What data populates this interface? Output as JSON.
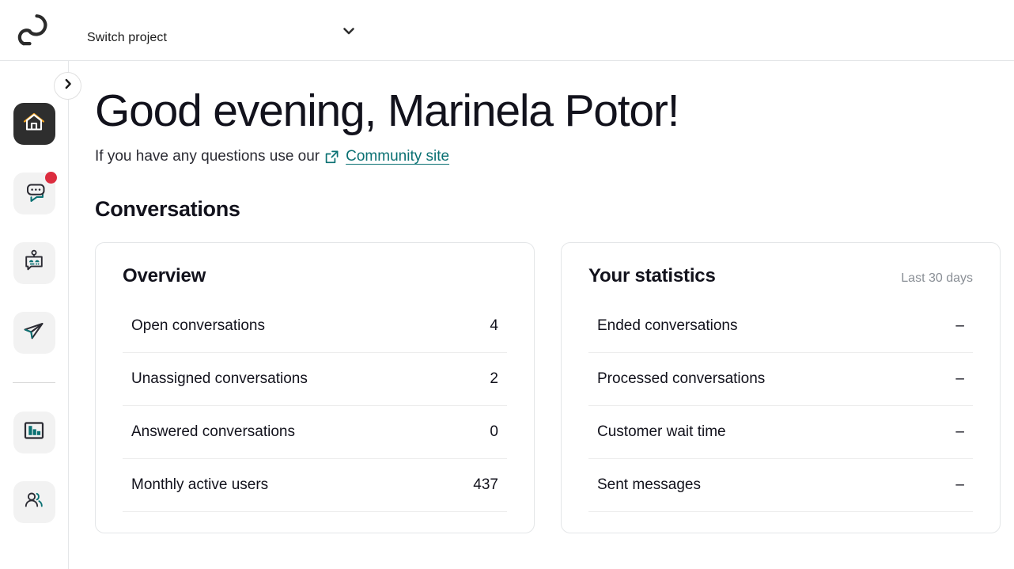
{
  "topbar": {
    "logo_icon": "userlike-logo-icon",
    "project_switcher_label": "Switch project",
    "chevron_icon": "chevron-down-icon"
  },
  "sidebar": {
    "collapse_icon": "chevron-right-icon",
    "items": [
      {
        "name": "home",
        "icon": "home-icon",
        "active": true,
        "badge": false
      },
      {
        "name": "messages",
        "icon": "chat-bubbles-icon",
        "active": false,
        "badge": true
      },
      {
        "name": "chatbot",
        "icon": "chatbot-icon",
        "active": false,
        "badge": false
      },
      {
        "name": "campaigns",
        "icon": "paper-plane-icon",
        "active": false,
        "badge": false
      },
      {
        "name": "analytics",
        "icon": "bar-chart-icon",
        "active": false,
        "badge": false
      },
      {
        "name": "contacts",
        "icon": "users-icon",
        "active": false,
        "badge": false
      }
    ]
  },
  "main": {
    "greeting": "Good evening, Marinela Potor!",
    "subline_text": "If you have any questions use our",
    "external_link_icon": "external-link-icon",
    "community_link": "Community site",
    "section_title": "Conversations"
  },
  "cards": [
    {
      "title": "Overview",
      "subtitle": "",
      "rows": [
        {
          "label": "Open conversations",
          "value": "4"
        },
        {
          "label": "Unassigned conversations",
          "value": "2"
        },
        {
          "label": "Answered conversations",
          "value": "0"
        },
        {
          "label": "Monthly active users",
          "value": "437"
        }
      ]
    },
    {
      "title": "Your statistics",
      "subtitle": "Last 30 days",
      "rows": [
        {
          "label": "Ended conversations",
          "value": "–"
        },
        {
          "label": "Processed conversations",
          "value": "–"
        },
        {
          "label": "Customer wait time",
          "value": "–"
        },
        {
          "label": "Sent messages",
          "value": "–"
        }
      ]
    }
  ],
  "colors": {
    "teal": "#0b7173",
    "dark": "#12121c",
    "badge_red": "#dc2d3f",
    "roof_orange": "#f5a623",
    "active_bg": "#2e2e2e",
    "tile_bg": "#f2f2f2"
  }
}
